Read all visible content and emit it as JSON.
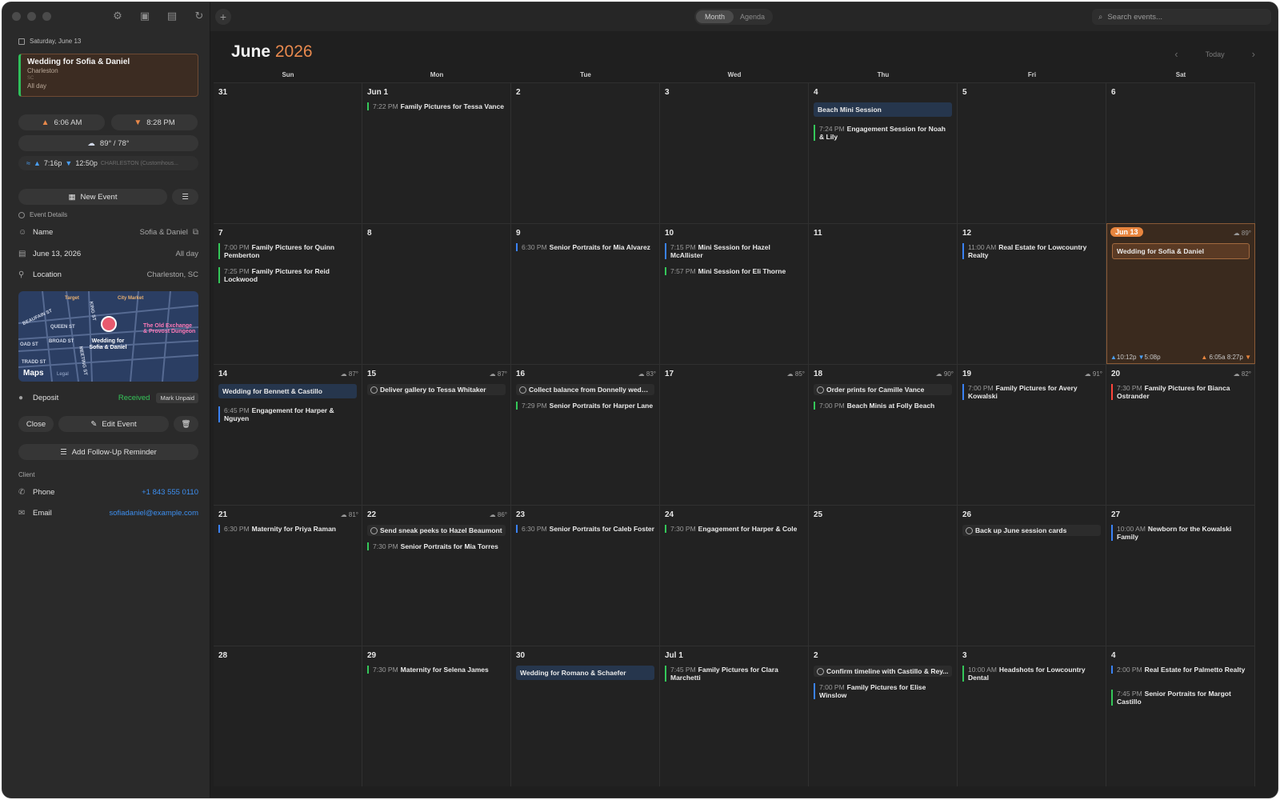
{
  "sidebar": {
    "date_header": "Saturday, June 13",
    "selected_event": {
      "title": "Wedding for Sofia & Daniel",
      "city": "Charleston",
      "state": "SC",
      "time": "All day"
    },
    "sunrise": "6:06 AM",
    "sunset": "8:28 PM",
    "weather": "89° / 78°",
    "tide_high": "7:16p",
    "tide_low": "12:50p",
    "tide_station": "CHARLESTON (Customhous...",
    "new_event_label": "New Event",
    "event_details_label": "Event Details",
    "name_label": "Name",
    "name_value": "Sofia & Daniel",
    "date_value": "June 13, 2026",
    "date_allday": "All day",
    "location_label": "Location",
    "location_value": "Charleston, SC",
    "map": {
      "streets": [
        "BEAUFAIN ST",
        "QUEEN ST",
        "BROAD ST",
        "OAD ST",
        "TRADD ST",
        "KING ST",
        "MEETING ST"
      ],
      "poi_target": "Target",
      "poi_market": "City Market",
      "poi_exchange": "The Old Exchange & Provost Dungeon",
      "pin_label": "Wedding for Sofia & Daniel",
      "brand": "Maps",
      "legal": "Legal"
    },
    "deposit_label": "Deposit",
    "deposit_status": "Received",
    "mark_unpaid_label": "Mark Unpaid",
    "close_label": "Close",
    "edit_label": "Edit Event",
    "followup_label": "Add Follow-Up Reminder",
    "client_label": "Client",
    "phone_label": "Phone",
    "phone_value": "+1 843 555 0110",
    "email_label": "Email",
    "email_value": "sofiadaniel@example.com"
  },
  "toolbar": {
    "view_month": "Month",
    "view_agenda": "Agenda",
    "search_placeholder": "Search events..."
  },
  "calendar": {
    "month": "June",
    "year": "2026",
    "today_label": "Today",
    "weekdays": [
      "Sun",
      "Mon",
      "Tue",
      "Wed",
      "Thu",
      "Fri",
      "Sat"
    ],
    "weeks": [
      [
        {
          "day": "31",
          "events": []
        },
        {
          "day": "Jun 1",
          "events": [
            {
              "time": "7:22 PM",
              "title": "Family Pictures for Tessa Vance",
              "color": "g"
            }
          ]
        },
        {
          "day": "2",
          "events": []
        },
        {
          "day": "3",
          "events": []
        },
        {
          "day": "4",
          "events": [
            {
              "allday": true,
              "title": "Beach Mini Session"
            },
            {
              "time": "7:24 PM",
              "title": "Engagement Session for Noah & Lily",
              "color": "g"
            }
          ]
        },
        {
          "day": "5",
          "events": []
        },
        {
          "day": "6",
          "events": []
        }
      ],
      [
        {
          "day": "7",
          "events": [
            {
              "time": "7:00 PM",
              "title": "Family Pictures for Quinn Pemberton",
              "color": "g"
            },
            {
              "time": "7:25 PM",
              "title": "Family Pictures for Reid Lockwood",
              "color": "g"
            }
          ]
        },
        {
          "day": "8",
          "events": []
        },
        {
          "day": "9",
          "events": [
            {
              "time": "6:30 PM",
              "title": "Senior Portraits for Mia Alvarez",
              "color": "b"
            }
          ]
        },
        {
          "day": "10",
          "events": [
            {
              "time": "7:15 PM",
              "title": "Mini Session for Hazel McAllister",
              "color": "b"
            },
            {
              "time": "7:57 PM",
              "title": "Mini Session for Eli Thorne",
              "color": "g"
            }
          ]
        },
        {
          "day": "11",
          "events": []
        },
        {
          "day": "12",
          "events": [
            {
              "time": "11:00 AM",
              "title": "Real Estate for Lowcountry Realty",
              "color": "b"
            }
          ]
        },
        {
          "day": "Jun 13",
          "today": true,
          "wx": "89°",
          "events": [
            {
              "allday": true,
              "today": true,
              "title": "Wedding for Sofia & Daniel"
            }
          ],
          "foot": {
            "high": "10:12p",
            "low": "5:08p",
            "rise": "6:05a",
            "set": "8:27p"
          }
        }
      ],
      [
        {
          "day": "14",
          "wx": "87°",
          "events": [
            {
              "allday": true,
              "title": "Wedding for Bennett & Castillo"
            },
            {
              "time": "6:45 PM",
              "title": "Engagement for Harper & Nguyen",
              "color": "b"
            }
          ]
        },
        {
          "day": "15",
          "wx": "87°",
          "events": [
            {
              "task": true,
              "title": "Deliver gallery to Tessa Whitaker"
            }
          ]
        },
        {
          "day": "16",
          "wx": "83°",
          "events": [
            {
              "task": true,
              "title": "Collect balance from Donnelly wedd..."
            },
            {
              "time": "7:29 PM",
              "title": "Senior Portraits for Harper Lane",
              "color": "g"
            }
          ]
        },
        {
          "day": "17",
          "wx": "85°",
          "events": []
        },
        {
          "day": "18",
          "wx": "90°",
          "events": [
            {
              "task": true,
              "title": "Order prints for Camille Vance"
            },
            {
              "time": "7:00 PM",
              "title": "Beach Minis at Folly Beach",
              "color": "g"
            }
          ]
        },
        {
          "day": "19",
          "wx": "91°",
          "events": [
            {
              "time": "7:00 PM",
              "title": "Family Pictures for Avery Kowalski",
              "color": "b"
            }
          ]
        },
        {
          "day": "20",
          "wx": "82°",
          "events": [
            {
              "time": "7:30 PM",
              "title": "Family Pictures for Bianca Ostrander",
              "color": "r"
            }
          ]
        }
      ],
      [
        {
          "day": "21",
          "wx": "81°",
          "events": [
            {
              "time": "6:30 PM",
              "title": "Maternity for Priya Raman",
              "color": "b"
            }
          ]
        },
        {
          "day": "22",
          "wx": "86°",
          "events": [
            {
              "task": true,
              "title": "Send sneak peeks to Hazel Beaumont"
            },
            {
              "time": "7:30 PM",
              "title": "Senior Portraits for Mia Torres",
              "color": "g"
            }
          ]
        },
        {
          "day": "23",
          "events": [
            {
              "time": "6:30 PM",
              "title": "Senior Portraits for Caleb Foster",
              "color": "b"
            }
          ]
        },
        {
          "day": "24",
          "events": [
            {
              "time": "7:30 PM",
              "title": "Engagement for Harper & Cole",
              "color": "g"
            }
          ]
        },
        {
          "day": "25",
          "events": []
        },
        {
          "day": "26",
          "events": [
            {
              "task": true,
              "title": "Back up June session cards"
            }
          ]
        },
        {
          "day": "27",
          "events": [
            {
              "time": "10:00 AM",
              "title": "Newborn for the Kowalski Family",
              "color": "b"
            }
          ]
        }
      ],
      [
        {
          "day": "28",
          "events": []
        },
        {
          "day": "29",
          "events": [
            {
              "time": "7:30 PM",
              "title": "Maternity for Selena James",
              "color": "g"
            }
          ]
        },
        {
          "day": "30",
          "events": [
            {
              "allday": true,
              "title": "Wedding for Romano & Schaefer"
            }
          ]
        },
        {
          "day": "Jul 1",
          "events": [
            {
              "time": "7:45 PM",
              "title": "Family Pictures for Clara Marchetti",
              "color": "g"
            }
          ]
        },
        {
          "day": "2",
          "events": [
            {
              "task": true,
              "title": "Confirm timeline with Castillo & Rey..."
            },
            {
              "time": "7:00 PM",
              "title": "Family Pictures for Elise Winslow",
              "color": "b"
            }
          ]
        },
        {
          "day": "3",
          "events": [
            {
              "time": "10:00 AM",
              "title": "Headshots for Lowcountry Dental",
              "color": "g"
            }
          ]
        },
        {
          "day": "4",
          "events": [
            {
              "time": "2:00 PM",
              "title": "Real Estate for Palmetto Realty",
              "color": "b"
            },
            {
              "time": "7:45 PM",
              "title": "Senior Portraits for Margot Castillo",
              "color": "g"
            }
          ]
        }
      ]
    ]
  }
}
